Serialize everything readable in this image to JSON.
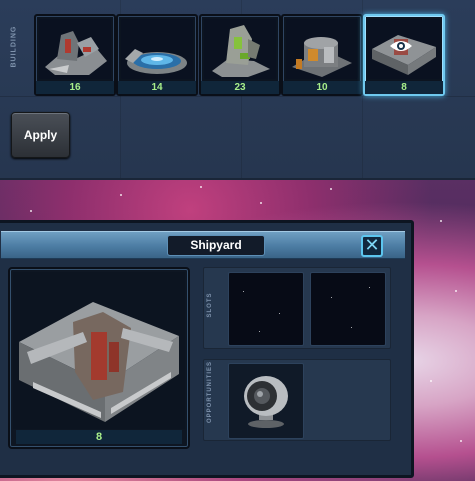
{
  "building_panel": {
    "label": "BUILDING",
    "items": [
      {
        "name": "structure-1",
        "count": "16"
      },
      {
        "name": "structure-2",
        "count": "14"
      },
      {
        "name": "structure-3",
        "count": "23"
      },
      {
        "name": "structure-4",
        "count": "10"
      },
      {
        "name": "shipyard",
        "count": "8",
        "selected": true,
        "icon": "eye-icon"
      }
    ],
    "apply_label": "Apply"
  },
  "dialog": {
    "title": "Shipyard",
    "close_icon": "close-icon",
    "building_count": "8",
    "slots_label": "SLOTS",
    "opportunities_label": "OPPORTUNITIES"
  },
  "colors": {
    "panel": "#2b3d5a",
    "count_text": "#a8ef8a",
    "selected_border": "#6fc9ef",
    "header": "#4c7ca3"
  }
}
